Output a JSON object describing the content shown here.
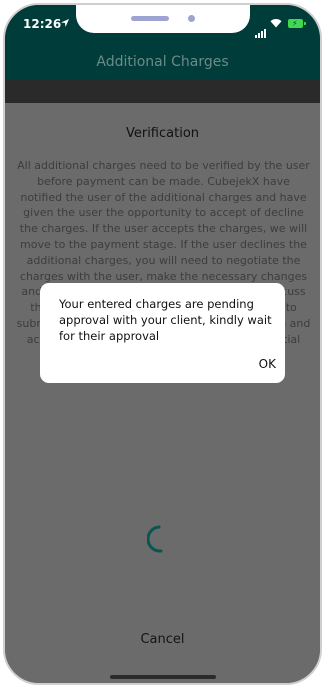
{
  "status_bar": {
    "time": "12:26"
  },
  "header": {
    "title": "Additional Charges"
  },
  "verification": {
    "title": "Verification",
    "text": "All additional charges need to be verified by the user before payment can be made. CubejekX have notified the user of the additional charges and have given the user the opportunity to accept of decline the charges. If the user accepts the charges, we will move to the payment stage. If the user declines the additional charges, you will need to negotiate the charges with the user, make the necessary changes and resubmit the charges. You may need to discuss the charges with the user before you are able to submit them for approval. Please be as thorough and accurate as possible when detailing any potential additional charges."
  },
  "cancel_label": "Cancel",
  "dialog": {
    "message": "Your entered charges are pending approval with your client, kindly wait for their approval",
    "ok_label": "OK"
  },
  "colors": {
    "header_bg": "#003c3a",
    "overlay": "#686868",
    "spinner": "#0a5552"
  }
}
